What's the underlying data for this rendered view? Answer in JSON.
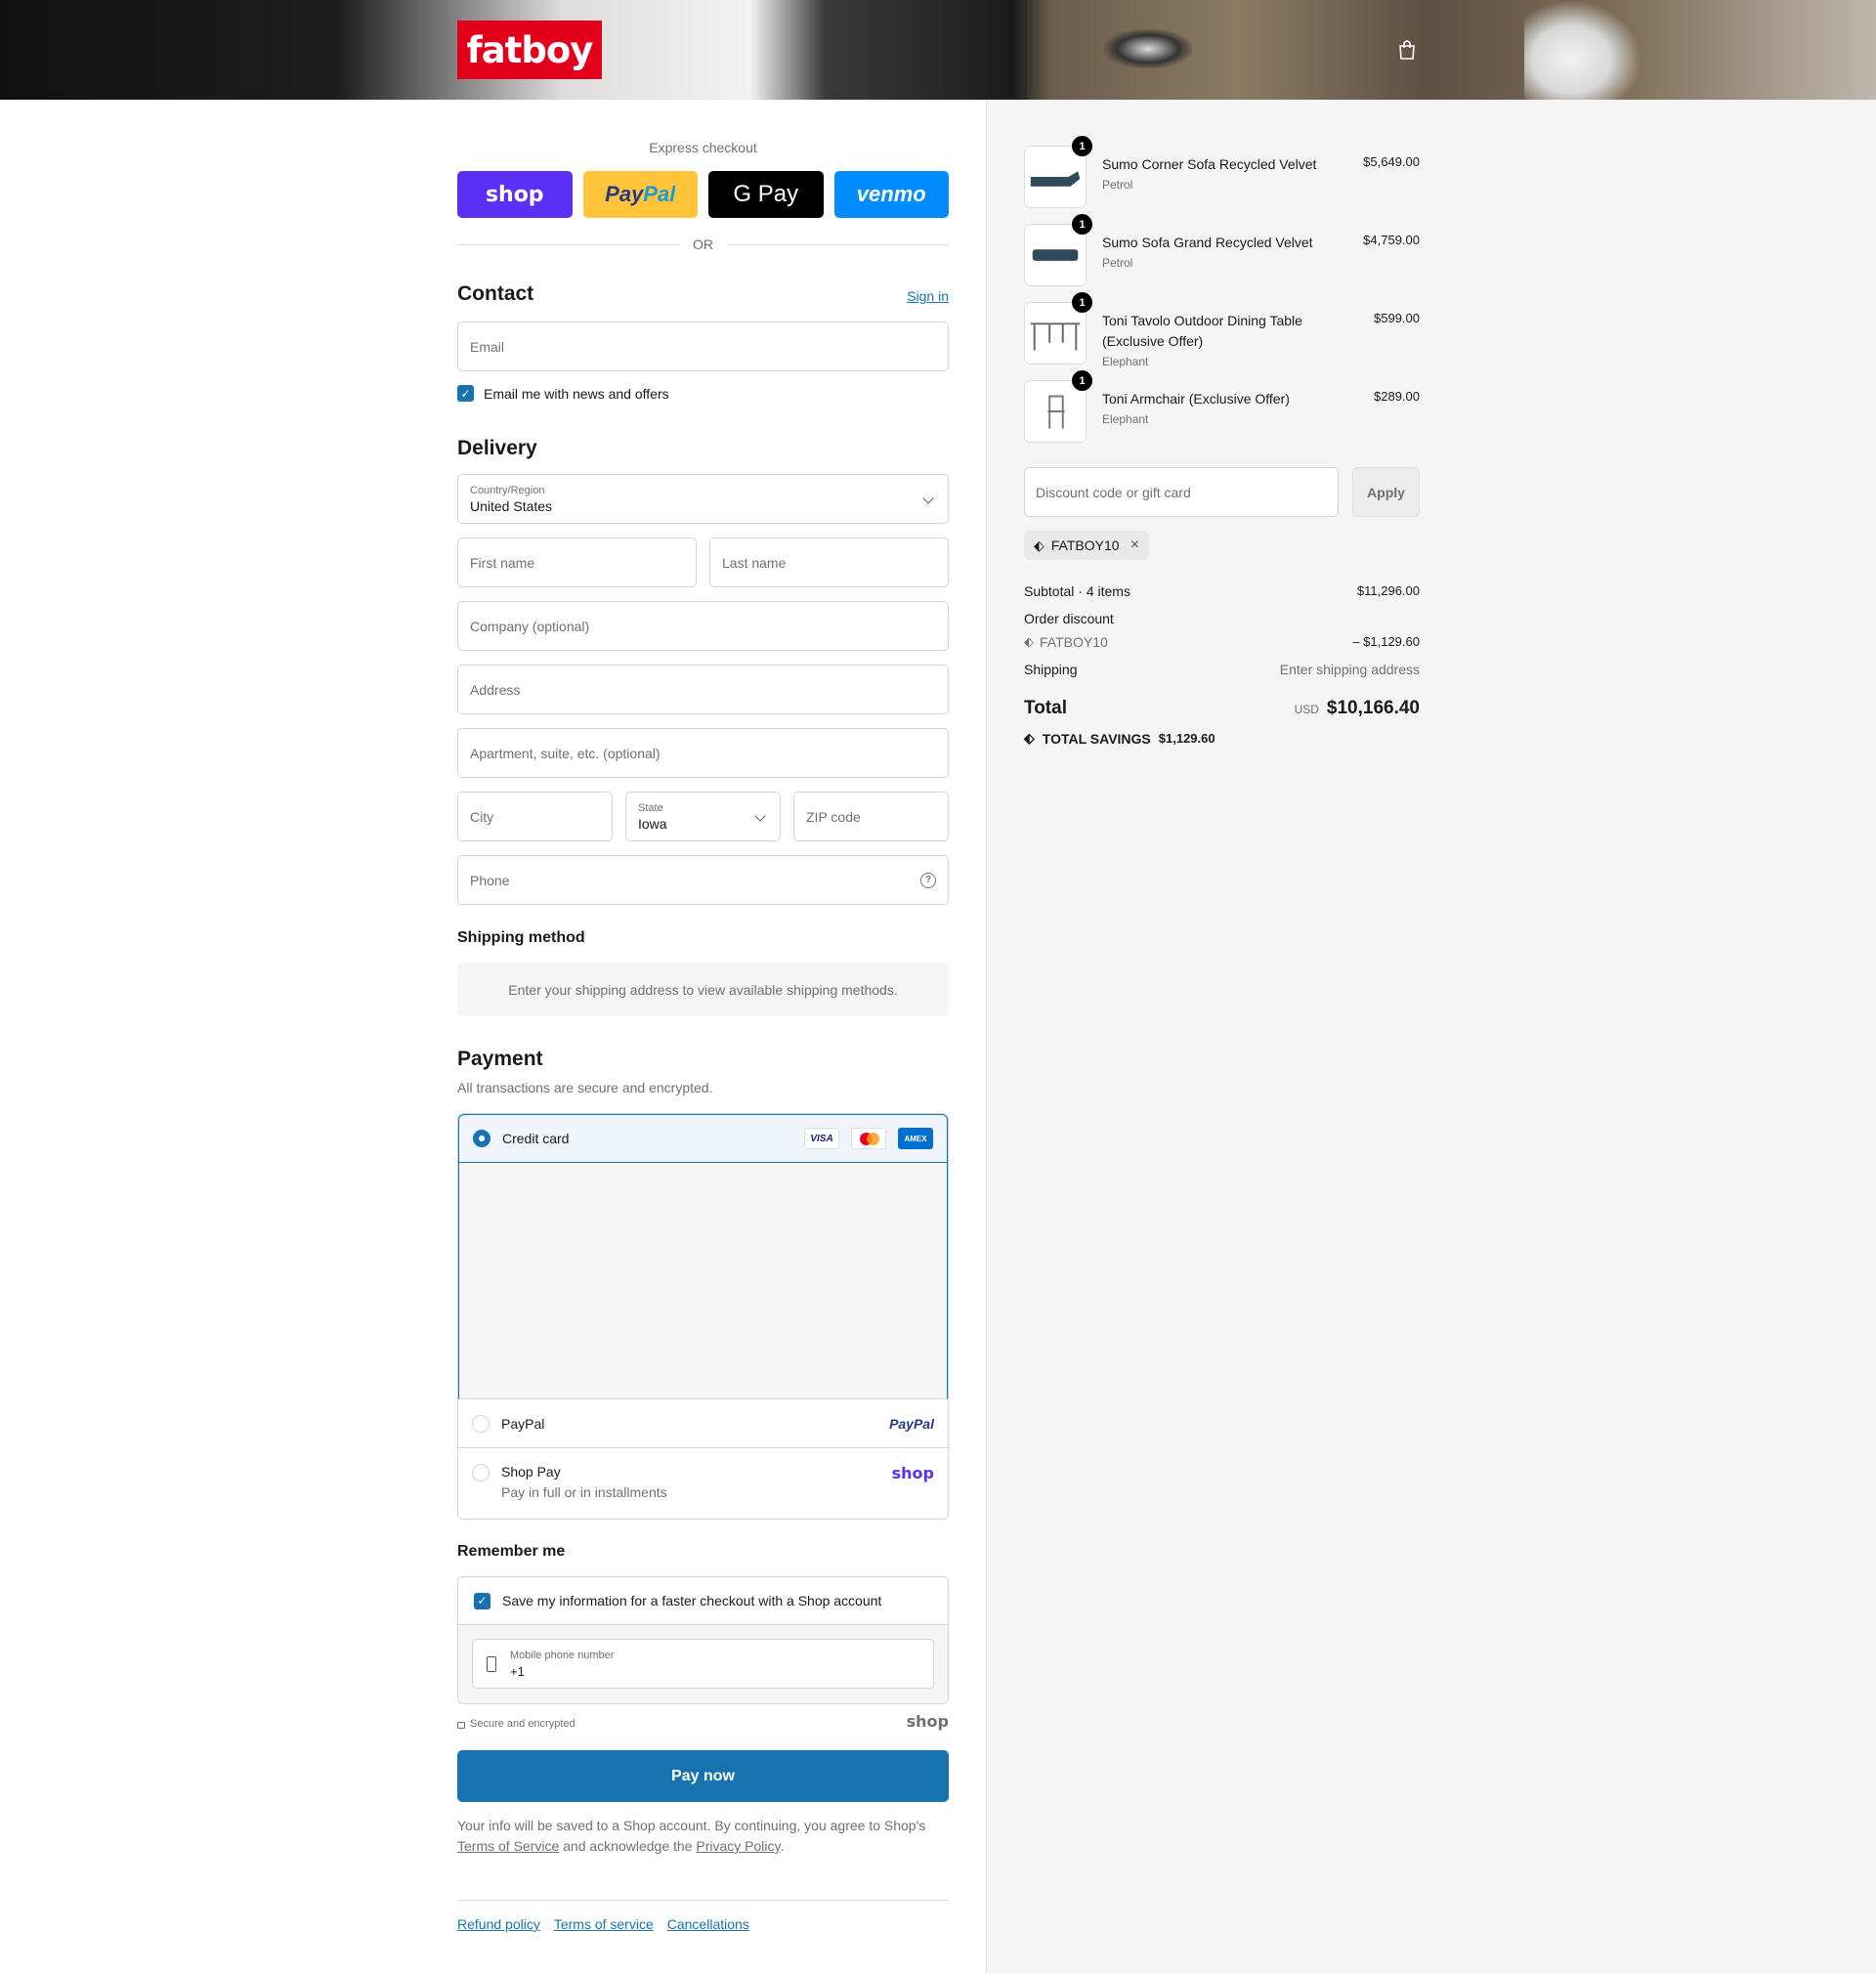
{
  "brand": {
    "logo_text": "fatboy"
  },
  "colors": {
    "accent": "#1773b0",
    "brand_red": "#e3001b",
    "shop_purple": "#5a31f4",
    "paypal_yellow": "#ffc439",
    "venmo_blue": "#008cff"
  },
  "express": {
    "title": "Express checkout",
    "buttons": [
      "shop",
      "PayPal",
      "G Pay",
      "venmo"
    ],
    "or": "OR"
  },
  "contact": {
    "heading": "Contact",
    "sign_in": "Sign in",
    "email_placeholder": "Email",
    "news_label": "Email me with news and offers"
  },
  "delivery": {
    "heading": "Delivery",
    "country_label": "Country/Region",
    "country_value": "United States",
    "first_name": "First name",
    "last_name": "Last name",
    "company": "Company (optional)",
    "address": "Address",
    "apartment": "Apartment, suite, etc. (optional)",
    "city": "City",
    "state_label": "State",
    "state_value": "Iowa",
    "zip": "ZIP code",
    "phone": "Phone"
  },
  "shipping_method": {
    "heading": "Shipping method",
    "message": "Enter your shipping address to view available shipping methods."
  },
  "payment": {
    "heading": "Payment",
    "subtitle": "All transactions are secure and encrypted.",
    "options": [
      {
        "label": "Credit card",
        "selected": true
      },
      {
        "label": "PayPal",
        "selected": false
      },
      {
        "label": "Shop Pay",
        "sub": "Pay in full or in installments",
        "selected": false
      }
    ],
    "card_brands": [
      "VISA",
      "Mastercard",
      "AMEX"
    ],
    "paypal_logo": "PayPal",
    "shop_logo": "shop"
  },
  "remember": {
    "heading": "Remember me",
    "save_label": "Save my information for a faster checkout with a Shop account",
    "phone_label": "Mobile phone number",
    "phone_value": "+1",
    "secure": "Secure and encrypted",
    "shop_logo": "shop"
  },
  "pay_button": "Pay now",
  "legal": {
    "text1": "Your info will be saved to a Shop account. By continuing, you agree to Shop's",
    "terms": "Terms of Service",
    "text2": "and acknowledge the",
    "privacy": "Privacy Policy",
    "end": "."
  },
  "footer": [
    "Refund policy",
    "Terms of service",
    "Cancellations"
  ],
  "cart": {
    "items": [
      {
        "name": "Sumo Corner Sofa Recycled Velvet",
        "variant": "Petrol",
        "price": "$5,649.00",
        "qty": "1"
      },
      {
        "name": "Sumo Sofa Grand Recycled Velvet",
        "variant": "Petrol",
        "price": "$4,759.00",
        "qty": "1"
      },
      {
        "name": "Toni Tavolo Outdoor Dining Table (Exclusive Offer)",
        "variant": "Elephant",
        "price": "$599.00",
        "qty": "1"
      },
      {
        "name": "Toni Armchair (Exclusive Offer)",
        "variant": "Elephant",
        "price": "$289.00",
        "qty": "1"
      }
    ],
    "discount_placeholder": "Discount code or gift card",
    "apply": "Apply",
    "applied_code": "FATBOY10",
    "subtotal_label": "Subtotal · 4 items",
    "subtotal": "$11,296.00",
    "order_discount_label": "Order discount",
    "discount_code": "FATBOY10",
    "discount_amount": "– $1,129.60",
    "shipping_label": "Shipping",
    "shipping_value": "Enter shipping address",
    "total_label": "Total",
    "currency": "USD",
    "total": "$10,166.40",
    "savings_label": "TOTAL SAVINGS",
    "savings": "$1,129.60"
  }
}
